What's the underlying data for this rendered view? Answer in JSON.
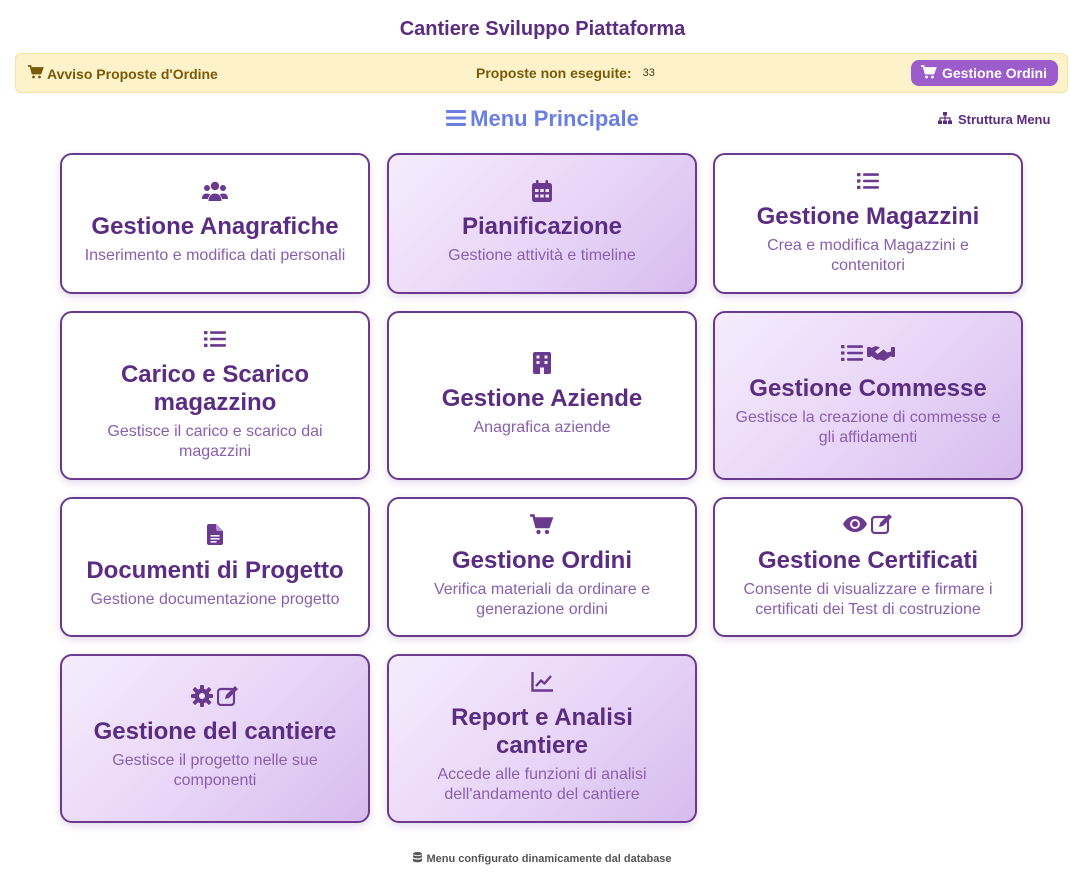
{
  "page": {
    "title": "Cantiere Sviluppo Piattaforma"
  },
  "alert": {
    "label": "Avviso Proposte d'Ordine",
    "pending_label": "Proposte non eseguite:",
    "pending_count": "33",
    "button_label": "Gestione Ordini"
  },
  "menu": {
    "title": "Menu Principale",
    "structure_link": "Struttura Menu"
  },
  "cards": [
    {
      "title": "Gestione Anagrafiche",
      "desc": "Inserimento e modifica dati personali",
      "icons": [
        "users-icon"
      ]
    },
    {
      "title": "Pianificazione",
      "desc": "Gestione attività e timeline",
      "icons": [
        "calendar-icon"
      ]
    },
    {
      "title": "Gestione Magazzini",
      "desc": "Crea e modifica Magazzini e contenitori",
      "icons": [
        "list-icon"
      ]
    },
    {
      "title": "Carico e Scarico magazzino",
      "desc": "Gestisce il carico e scarico dai magazzini",
      "icons": [
        "list-icon"
      ]
    },
    {
      "title": "Gestione Aziende",
      "desc": "Anagrafica aziende",
      "icons": [
        "building-icon"
      ]
    },
    {
      "title": "Gestione Commesse",
      "desc": "Gestisce la creazione di commesse e gli affidamenti",
      "icons": [
        "list-icon",
        "handshake-icon"
      ]
    },
    {
      "title": "Documenti di Progetto",
      "desc": "Gestione documentazione progetto",
      "icons": [
        "file-icon"
      ]
    },
    {
      "title": "Gestione Ordini",
      "desc": "Verifica materiali da ordinare e generazione ordini",
      "icons": [
        "cart-icon"
      ]
    },
    {
      "title": "Gestione Certificati",
      "desc": "Consente di visualizzare e firmare i certificati dei Test di costruzione",
      "icons": [
        "eye-icon",
        "edit-icon"
      ]
    },
    {
      "title": "Gestione del cantiere",
      "desc": "Gestisce il progetto nelle sue componenti",
      "icons": [
        "gear-icon",
        "edit-icon"
      ]
    },
    {
      "title": "Report e Analisi cantiere",
      "desc": "Accede alle funzioni di analisi dell'andamento del cantiere",
      "icons": [
        "chart-line-icon"
      ]
    }
  ],
  "footer": {
    "note": "Menu configurato dinamicamente dal database"
  },
  "colors": {
    "primary": "#5b2d82",
    "accent": "#6b7fe0",
    "alert_bg": "#fdf2c9",
    "button": "#9c5ccc"
  }
}
